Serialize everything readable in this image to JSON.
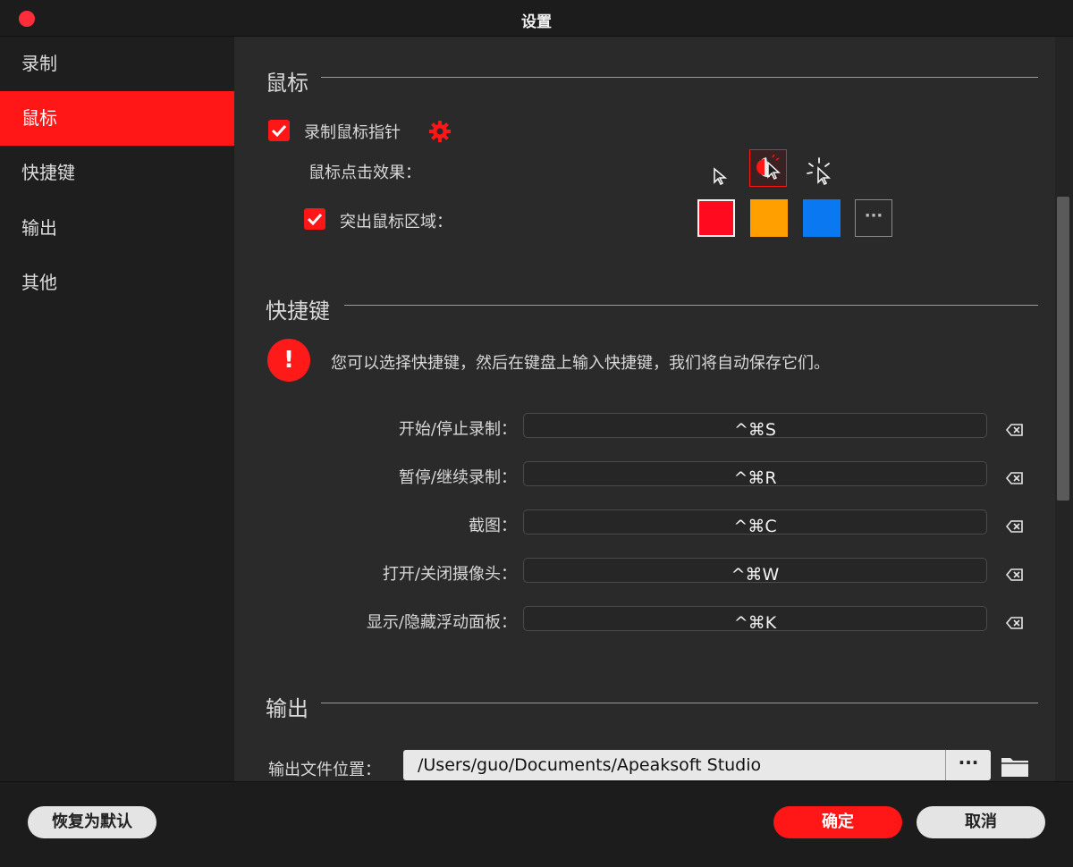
{
  "window": {
    "title": "设置"
  },
  "sidebar": {
    "items": [
      {
        "label": "录制"
      },
      {
        "label": "鼠标",
        "active": true
      },
      {
        "label": "快捷键"
      },
      {
        "label": "输出"
      },
      {
        "label": "其他"
      }
    ]
  },
  "mouse": {
    "heading": "鼠标",
    "record_cursor_label": "录制鼠标指针",
    "record_cursor_checked": true,
    "click_effect_label": "鼠标点击效果：",
    "click_effects": [
      "plain-cursor-icon",
      "click-ripple-cursor-icon",
      "sparkle-cursor-icon"
    ],
    "click_effect_selected": "click-ripple-cursor-icon",
    "highlight_label": "突出鼠标区域：",
    "highlight_checked": true,
    "highlight_colors": [
      "#ff0a1e",
      "#ffa000",
      "#0a78f0"
    ],
    "highlight_more_label": "···"
  },
  "hotkeys": {
    "heading": "快捷键",
    "info_icon_text": "!",
    "info_text": "您可以选择快捷键，然后在键盘上输入快捷键，我们将自动保存它们。",
    "items": [
      {
        "label": "开始/停止录制：",
        "value": "^⌘S"
      },
      {
        "label": "暂停/继续录制：",
        "value": "^⌘R"
      },
      {
        "label": "截图：",
        "value": "^⌘C"
      },
      {
        "label": "打开/关闭摄像头：",
        "value": "^⌘W"
      },
      {
        "label": "显示/隐藏浮动面板：",
        "value": "^⌘K"
      }
    ]
  },
  "output": {
    "heading": "输出",
    "location_label": "输出文件位置：",
    "location_value": "/Users/guo/Documents/Apeaksoft Studio",
    "browse_label": "···"
  },
  "footer": {
    "reset_label": "恢复为默认",
    "ok_label": "确定",
    "cancel_label": "取消"
  },
  "colors": {
    "accent": "#ff1616"
  }
}
